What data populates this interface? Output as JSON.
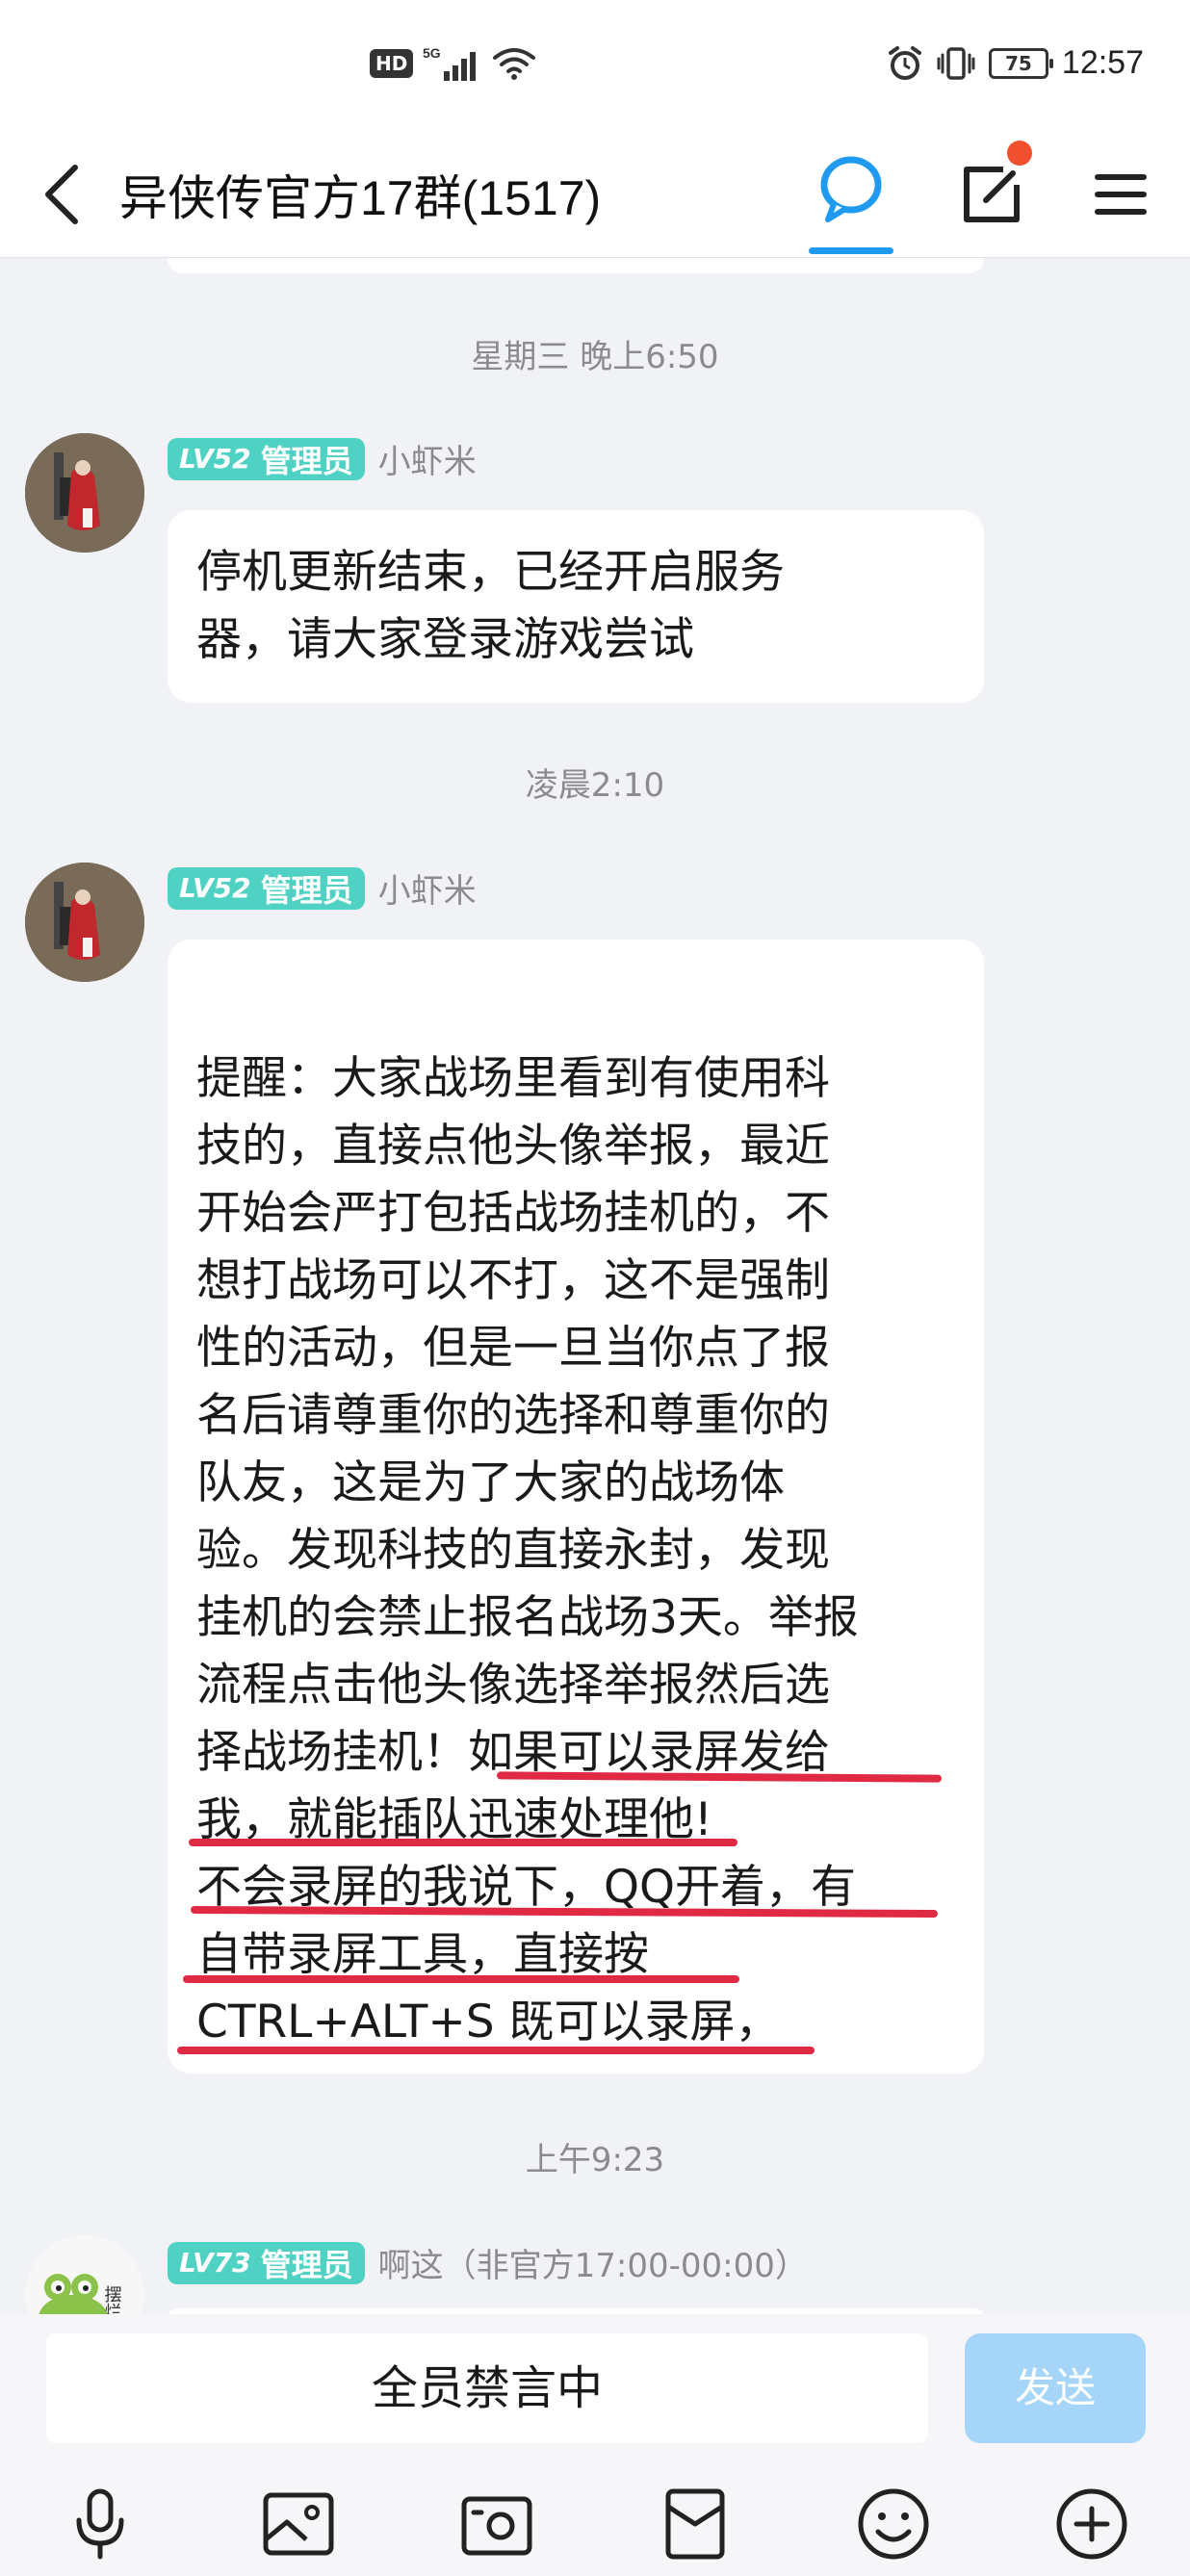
{
  "status_bar": {
    "hd": "HD",
    "network": "5G",
    "battery": "75",
    "time": "12:57"
  },
  "header": {
    "title": "异侠传官方17群(1517)"
  },
  "messages": [
    {
      "timestamp": "星期三 晚上6:50",
      "lv": "LV52",
      "role": "管理员",
      "nick": "小虾米",
      "lines": [
        "停机更新结束，已经开启服务",
        "器，请大家登录游戏尝试"
      ]
    },
    {
      "timestamp": "凌晨2:10",
      "lv": "LV52",
      "role": "管理员",
      "nick": "小虾米",
      "lines": [
        "提醒：大家战场里看到有使用科",
        "技的，直接点他头像举报，最近",
        "开始会严打包括战场挂机的，不",
        "想打战场可以不打，这不是强制",
        "性的活动，但是一旦当你点了报",
        "名后请尊重你的选择和尊重你的",
        "队友，这是为了大家的战场体",
        "验。发现科技的直接永封，发现",
        "挂机的会禁止报名战场3天。举报",
        "流程点击他头像选择举报然后选",
        "择战场挂机！如果可以录屏发给",
        "我，就能插队迅速处理他!",
        "不会录屏的我说下，QQ开着，有",
        "自带录屏工具，直接按",
        "CTRL+ALT+S 既可以录屏，"
      ]
    },
    {
      "timestamp": "上午9:23",
      "lv": "LV73",
      "role": "管理员",
      "nick": "啊这（非官方17:00-00:00）",
      "avatar_text": "摆烂"
    }
  ],
  "input": {
    "muted_text": "全员禁言中",
    "send_label": "发送"
  },
  "colors": {
    "accent": "#1e9bf0",
    "badge": "#4fd2c3",
    "underline_red": "#e02a44",
    "send_disabled": "#a5d6fa",
    "notif_dot": "#f1502f"
  }
}
